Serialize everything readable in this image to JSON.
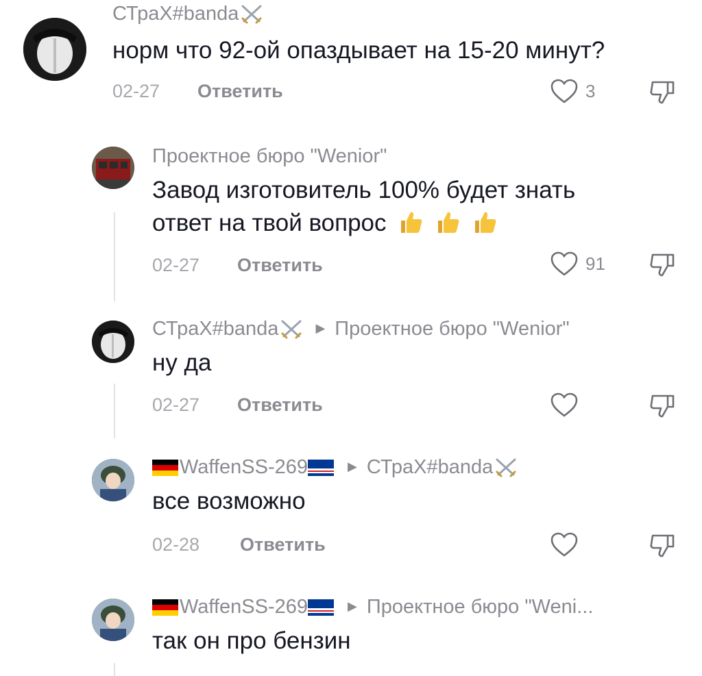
{
  "comments": [
    {
      "author": "СТраХ#banda",
      "text": "норм что 92-ой опаздывает на 15-20 минут?",
      "date": "02-27",
      "reply_label": "Ответить",
      "likes": "3"
    },
    {
      "author": "Проектное бюро \"Wenior\"",
      "text_line1": "Завод изготовитель 100% будет знать",
      "text_line2": "ответ на твой вопрос",
      "date": "02-27",
      "reply_label": "Ответить",
      "likes": "91"
    },
    {
      "author": "СТраХ#banda",
      "reply_to": "Проектное бюро \"Wenior\"",
      "text": "ну да",
      "date": "02-27",
      "reply_label": "Ответить"
    },
    {
      "author": "WaffenSS-269",
      "reply_to": "СТраХ#banda",
      "text": "все возможно",
      "date": "02-28",
      "reply_label": "Ответить"
    },
    {
      "author": "WaffenSS-269",
      "reply_to": "Проектное бюро \"Weni...",
      "text": "так он про бензин"
    }
  ],
  "icons": {
    "like": "heart-outline-icon",
    "dislike": "thumbs-down-outline-icon",
    "reply_arrow": "triangle-right-icon",
    "swords": "crossed-swords-icon",
    "thumbs_up": "thumbs-up-emoji-icon"
  },
  "colors": {
    "text": "#161823",
    "secondary": "#8a8b91",
    "date": "#a7a8ad"
  }
}
